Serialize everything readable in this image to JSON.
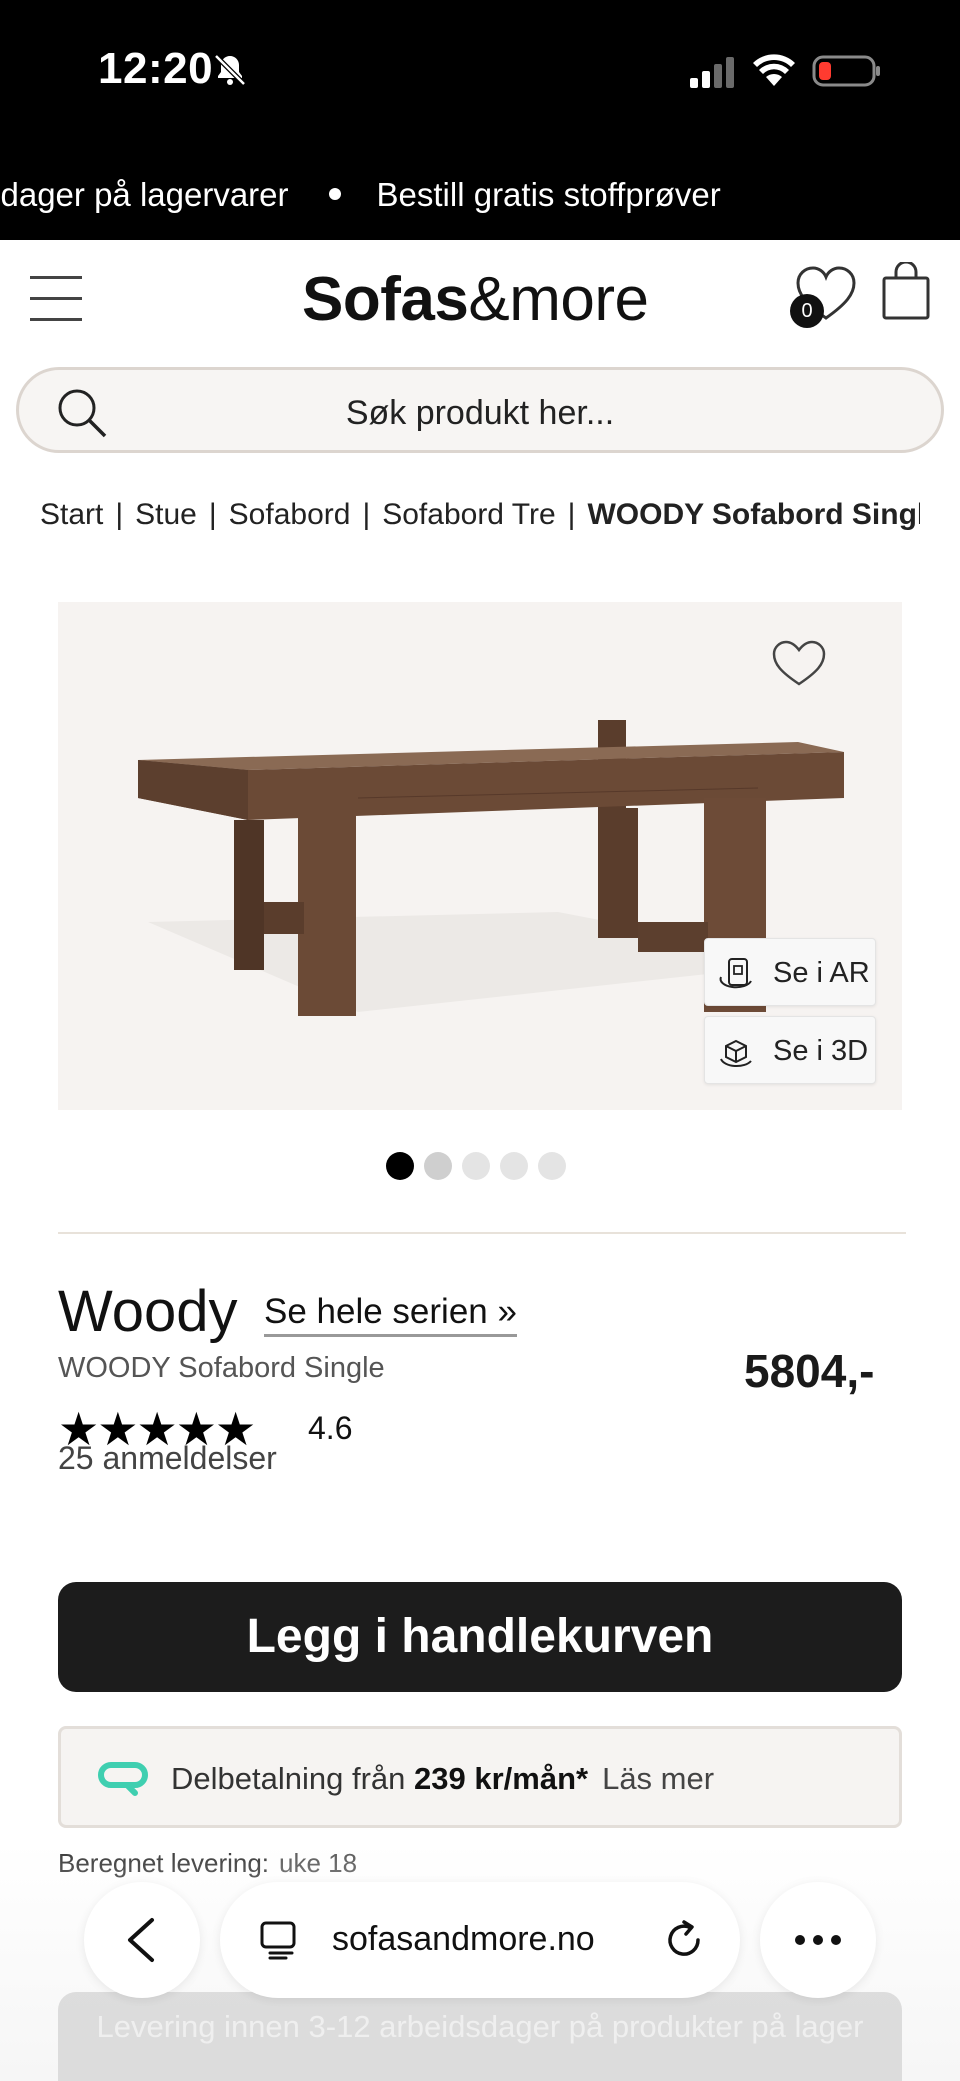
{
  "status_bar": {
    "time": "12:20"
  },
  "ticker": {
    "item1": "sdager på lagervarer",
    "item2": "Bestill gratis stoffprøver"
  },
  "header": {
    "logo_bold": "Sofas",
    "logo_rest": "&more",
    "wishlist_count": "0"
  },
  "search": {
    "placeholder": "Søk produkt her..."
  },
  "breadcrumb": {
    "items": [
      "Start",
      "Stue",
      "Sofabord",
      "Sofabord Tre",
      "WOODY Sofabord Single"
    ],
    "separator": "|"
  },
  "gallery": {
    "ar_label": "Se i AR",
    "view3d_label": "Se i 3D",
    "total_images": 5,
    "active_index": 1
  },
  "product": {
    "title": "Woody",
    "series_link": "Se hele serien »",
    "subtitle": "WOODY Sofabord Single",
    "price": "5804,-",
    "stars": "★★★★★",
    "rating": "4.6",
    "reviews": "25 anmeldelser"
  },
  "cart": {
    "button_label": "Legg i handlekurven"
  },
  "installment": {
    "prefix": "Delbetalning från",
    "amount": "239 kr/mån*",
    "more": "Läs mer"
  },
  "delivery": {
    "label": "Beregnet levering:",
    "value": "uke 18",
    "banner": "Levering innen 3-12 arbeidsdager på produkter på lager"
  },
  "browser": {
    "url": "sofasandmore.no"
  },
  "colors": {
    "primary_button": "#1c1c1c",
    "installment_icon": "#3fcfb0",
    "wood": "#6b4a36"
  }
}
